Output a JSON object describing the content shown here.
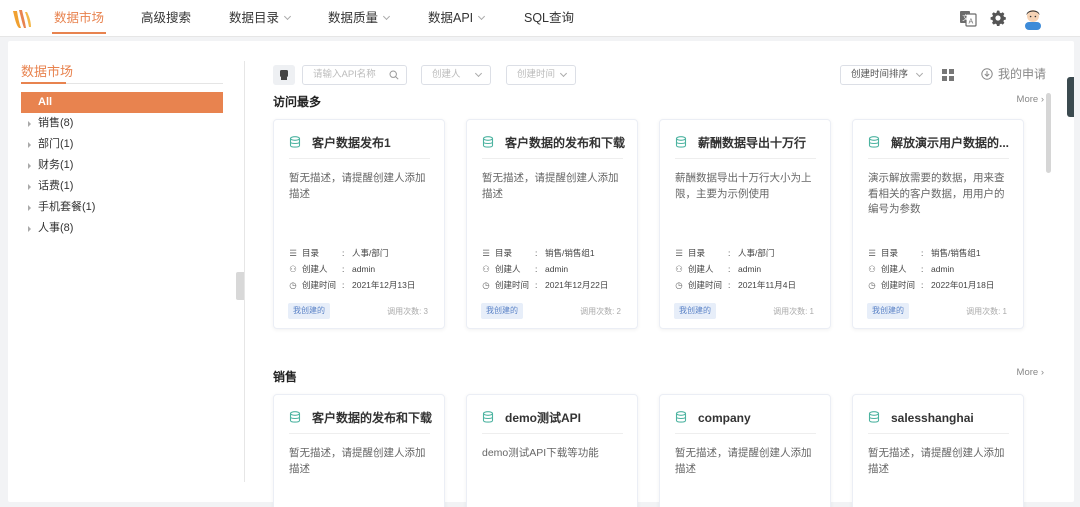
{
  "nav": {
    "items": [
      {
        "label": "数据市场",
        "active": true
      },
      {
        "label": "高级搜索"
      },
      {
        "label": "数据目录"
      },
      {
        "label": "数据质量"
      },
      {
        "label": "数据API"
      },
      {
        "label": "SQL查询"
      }
    ],
    "icons": [
      "translate-icon",
      "gear-icon",
      "avatar"
    ]
  },
  "sidebar": {
    "title": "数据市场",
    "items": [
      {
        "label": "All",
        "active": true
      },
      {
        "label": "销售(8)"
      },
      {
        "label": "部门(1)"
      },
      {
        "label": "财务(1)"
      },
      {
        "label": "话费(1)"
      },
      {
        "label": "手机套餐(1)"
      },
      {
        "label": "人事(8)"
      }
    ]
  },
  "filters": {
    "search_placeholder": "请输入API名称",
    "creator_placeholder": "创建人",
    "time_placeholder": "创建时间",
    "sort_label": "创建时间排序",
    "apply_label": "我的申请"
  },
  "colors": {
    "accent": "#e8834f",
    "tag_bg": "#e7eef9",
    "tag_text": "#5b83c7",
    "db_icon": "#4cb3a0"
  },
  "sections": [
    {
      "title": "访问最多",
      "more": "More",
      "cards": [
        {
          "title": "客户数据发布1",
          "desc": "暂无描述，请提醒创建人添加描述",
          "catalog": "人事/部门",
          "creator": "admin",
          "created": "2021年12月13日",
          "tag": "我创建的",
          "calls": "调用次数: 3"
        },
        {
          "title": "客户数据的发布和下载",
          "desc": "暂无描述，请提醒创建人添加描述",
          "catalog": "销售/销售组1",
          "creator": "admin",
          "created": "2021年12月22日",
          "tag": "我创建的",
          "calls": "调用次数: 2"
        },
        {
          "title": "薪酬数据导出十万行",
          "desc": "薪酬数据导出十万行大小为上限，主要为示例使用",
          "catalog": "人事/部门",
          "creator": "admin",
          "created": "2021年11月4日",
          "tag": "我创建的",
          "calls": "调用次数: 1"
        },
        {
          "title": "解放演示用户数据的...",
          "desc": "演示解放需要的数据，用来查看相关的客户数据，用用户的编号为参数",
          "catalog": "销售/销售组1",
          "creator": "admin",
          "created": "2022年01月18日",
          "tag": "我创建的",
          "calls": "调用次数: 1"
        }
      ]
    },
    {
      "title": "销售",
      "more": "More",
      "cards": [
        {
          "title": "客户数据的发布和下载",
          "desc": "暂无描述，请提醒创建人添加描述"
        },
        {
          "title": "demo测试API",
          "desc": "demo测试API下载等功能"
        },
        {
          "title": "company",
          "desc": "暂无描述，请提醒创建人添加描述"
        },
        {
          "title": "salesshanghai",
          "desc": "暂无描述，请提醒创建人添加描述"
        }
      ]
    }
  ],
  "meta_labels": {
    "catalog": "目录",
    "creator": "创建人",
    "created": "创建时间",
    "colon": ":"
  }
}
